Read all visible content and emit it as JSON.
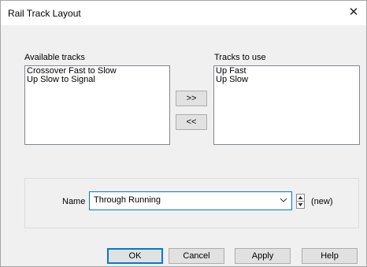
{
  "window": {
    "title": "Rail Track Layout"
  },
  "available": {
    "label": "Available tracks",
    "items": [
      "Crossover Fast to Slow",
      "Up Slow to Signal"
    ]
  },
  "to_use": {
    "label": "Tracks to use",
    "items": [
      "Up Fast",
      "Up Slow"
    ]
  },
  "move": {
    "add_label": ">>",
    "remove_label": "<<"
  },
  "name_field": {
    "label": "Name",
    "value": "Through Running",
    "status": "(new)"
  },
  "footer": {
    "ok": "OK",
    "cancel": "Cancel",
    "apply": "Apply",
    "help": "Help"
  },
  "colors": {
    "accent": "#0078d7",
    "dialog_bg": "#f0f0f0",
    "button_bg": "#e1e1e1"
  }
}
